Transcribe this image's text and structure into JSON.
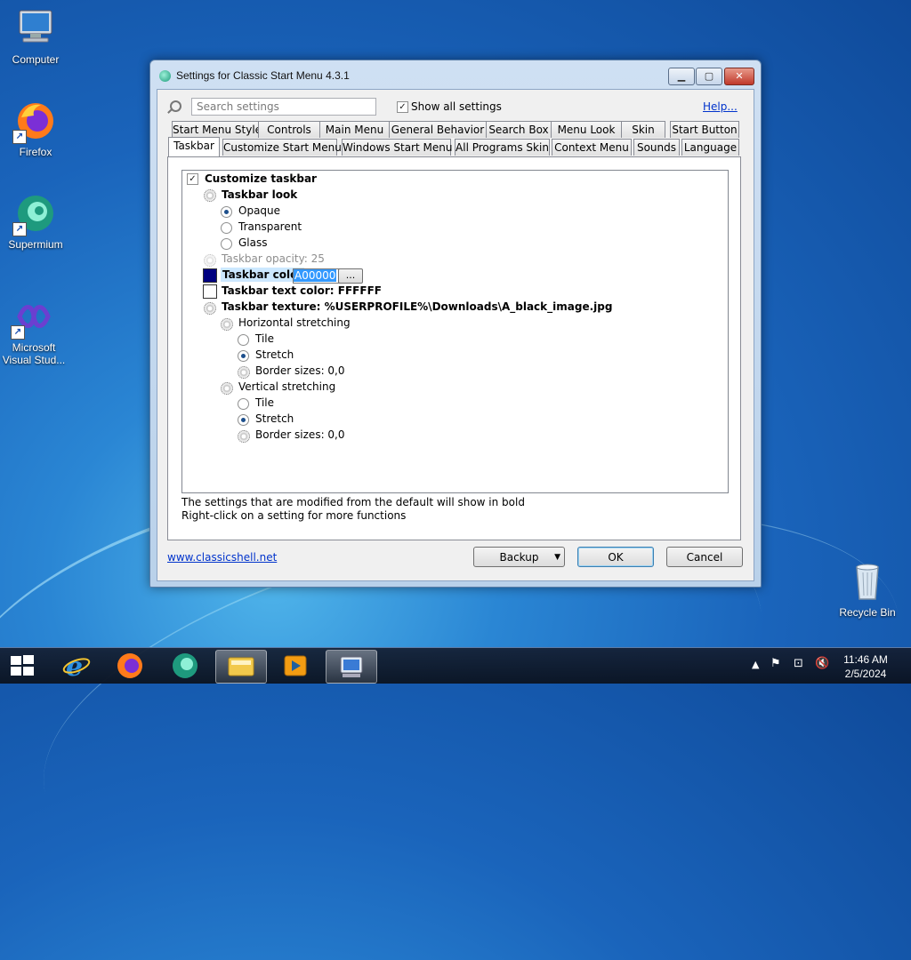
{
  "desktop": {
    "icons": [
      {
        "label": "Computer"
      },
      {
        "label": "Firefox"
      },
      {
        "label": "Supermium"
      },
      {
        "label": "Microsoft Visual Stud..."
      },
      {
        "label": "Recycle Bin"
      }
    ]
  },
  "window": {
    "title": "Settings for Classic Start Menu 4.3.1",
    "search_placeholder": "Search settings",
    "show_all_label": "Show all settings",
    "show_all_checked": true,
    "help_link": "Help...",
    "tabs_row1": [
      "Start Menu Style",
      "Controls",
      "Main Menu",
      "General Behavior",
      "Search Box",
      "Menu Look",
      "Skin",
      "Start Button"
    ],
    "tabs_row2": [
      "Taskbar",
      "Customize Start Menu",
      "Windows Start Menu",
      "All Programs Skin",
      "Context Menu",
      "Sounds",
      "Language"
    ],
    "active_tab": "Taskbar",
    "tree": {
      "customize_taskbar": "Customize taskbar",
      "taskbar_look": "Taskbar look",
      "opaque": "Opaque",
      "transparent": "Transparent",
      "glass": "Glass",
      "taskbar_opacity": "Taskbar opacity: 25",
      "taskbar_color": "Taskbar color",
      "taskbar_color_value": "A00000",
      "ellipsis": "...",
      "taskbar_text_color": "Taskbar text color: FFFFFF",
      "taskbar_texture": "Taskbar texture: %USERPROFILE%\\Downloads\\A_black_image.jpg",
      "horizontal_stretching": "Horizontal stretching",
      "h_tile": "Tile",
      "h_stretch": "Stretch",
      "h_border": "Border sizes: 0,0",
      "vertical_stretching": "Vertical stretching",
      "v_tile": "Tile",
      "v_stretch": "Stretch",
      "v_border": "Border sizes: 0,0"
    },
    "swatch_colors": {
      "taskbar": "#000080",
      "text": "#FFFFFF"
    },
    "hint_line1": "The settings that are modified from the default will show in bold",
    "hint_line2": "Right-click on a setting for more functions",
    "site_link": "www.classicshell.net",
    "backup_label": "Backup",
    "ok_label": "OK",
    "cancel_label": "Cancel"
  },
  "taskbar": {
    "time": "11:46 AM",
    "date": "2/5/2024"
  }
}
